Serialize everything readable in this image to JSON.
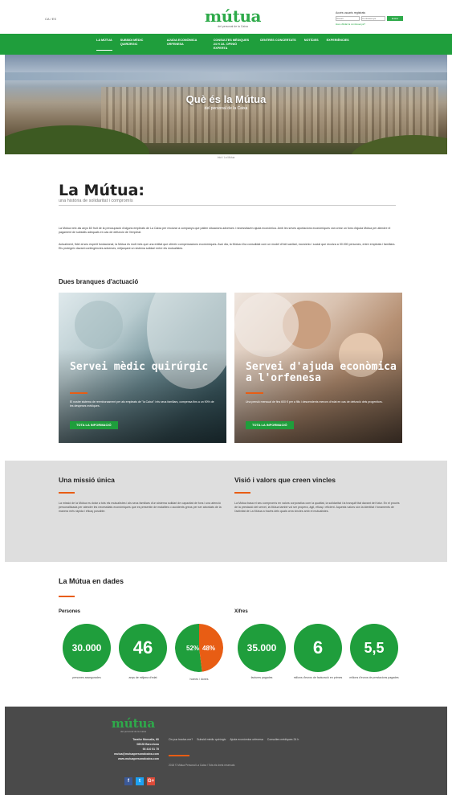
{
  "header": {
    "lang": "CA / ES",
    "logo": "mútua",
    "logo_sub": "del personal de la Caixa",
    "login_title": "Accés usuaris registrats",
    "login_user_placeholder": "Usuari",
    "login_pass_placeholder": "Contrasenya",
    "login_button": "Entrar",
    "login_forgot": "Has oblidat la contrasenya?"
  },
  "nav": {
    "items": [
      {
        "label": "LA MÚTUA"
      },
      {
        "label": "SUBSIDI MÈDIC QUIRÚRGIC"
      },
      {
        "label": "AJUDA ECONÒMICA ORFENESA"
      },
      {
        "label": "CONSULTES MÈDIQUES 24 H 2A. OPINIÓ EXPERTA"
      },
      {
        "label": "CENTRES CONCERTATS"
      },
      {
        "label": "NOTÍCIES"
      },
      {
        "label": "EXPERIÈNCIES"
      }
    ]
  },
  "hero": {
    "title": "Què és la Mútua",
    "subtitle": "del personal de la Caixa",
    "breadcrumb": "Inici / La Mútua"
  },
  "intro": {
    "title": "La Mútua:",
    "subtitle": "una història de solidaritat i compromís",
    "p1": "La Mútua neix als anys 60 fruit de la preocupació d'alguns empleats de La Caixa per recolzar a companys que patien situacions adverses i necessitaven ajuda econòmica. Amb les seves aportacions econòmiques van crear un fons d'ajuda Mútua per atendre el pagament de subsidis adequats en cas de defunció de l'empleat.",
    "p2": "Actualment, fidel al seu esperit fundacional, la Mútua és molt més que una entitat que ofereix compensacions econòmiques. Avui dia, la Mútua s'ha consolidat com un model d'èxit sanitari, econòmic i social que recolza a 30.000 persones, entre empleats i familiars. Els protegeix davant contingències adverses, mitjançant un sistema solidari entre els mutualistes."
  },
  "branches": {
    "heading": "Dues branques d'actuació",
    "cards": [
      {
        "title": "Servei mèdic quirúrgic",
        "text": "El nostre sistema de reemborsament per als empleats de \"la Caixa\" i els seus familiars, compensa fins a un 90% de les despeses mèdiques.",
        "button": "TOTA LA INFORMACIÓ"
      },
      {
        "title": "Servei d'ajuda econòmica a l'orfenesa",
        "text": "Una pensió mensual de fins 600 € per a fills i descendents menors d'edat en cas de defunció dels progenitors.",
        "button": "TOTA LA INFORMACIÓ"
      }
    ]
  },
  "values": {
    "col1_title": "Una missió única",
    "col1_text": "La missió de la Mútua es dotar a tots els mutualistes i als seus familiars d'un sistema solidari de capacitat de fons i una atenció personalitzada per atendre les necessitats econòmiques que es presentin de malalties o accidents greus per ser abordats de la manera més ràpida i eficaç possible.",
    "col2_title": "Visió i valors que creen vincles",
    "col2_text": "La Mútua basa el seu compromís en valors corporatius com la qualitat, la solidaritat i la tranquil·litat davant del futur. En el procés de la prestació del servei, la Mútua també vol ser propera, àgil, eficaç i eficient. Aquests valors són la identitat i fonaments de l'activitat de La Mútua a través dels quals crea vincles amb el mutualistes."
  },
  "stats": {
    "heading": "La Mútua en dades",
    "group1": "Persones",
    "group2": "Xifres",
    "items": [
      {
        "value": "30.000",
        "label": "persones assegurades"
      },
      {
        "value": "46",
        "label": "anys de mitjana d'edat"
      },
      {
        "value": "35.000",
        "label": "factures pagades"
      },
      {
        "value": "6",
        "label": "milions d'euros de facturació en primes"
      },
      {
        "value": "5,5",
        "label": "milions d'euros de prestacions pagades"
      }
    ],
    "pie": {
      "men_pct": 52,
      "women_pct": 48,
      "men_label": "52%",
      "women_label": "48%",
      "label": "homes / dones",
      "men_color": "#1f9e3c",
      "women_color": "#e85d14"
    }
  },
  "footer": {
    "logo": "mútua",
    "logo_sub": "del personal de la Caixa",
    "address1": "Tarafor Morsalla, 60",
    "address2": "08028 Barcelona",
    "phone": "93 410 51 75",
    "email": "mutua@mutuapersonalcaixa.com",
    "web": "www.mutuapersonalcaixa.com",
    "links": [
      "On puc tractar-me?",
      "Subsidi mèdic quirúrgic",
      "Ajuda econòmica orfenesa",
      "Consultes mèdiques 24 h"
    ],
    "copyright": "2018 © Mútua Personal La Caixa / Tots els drets reservats",
    "social": [
      "f",
      "t",
      "G+"
    ]
  }
}
